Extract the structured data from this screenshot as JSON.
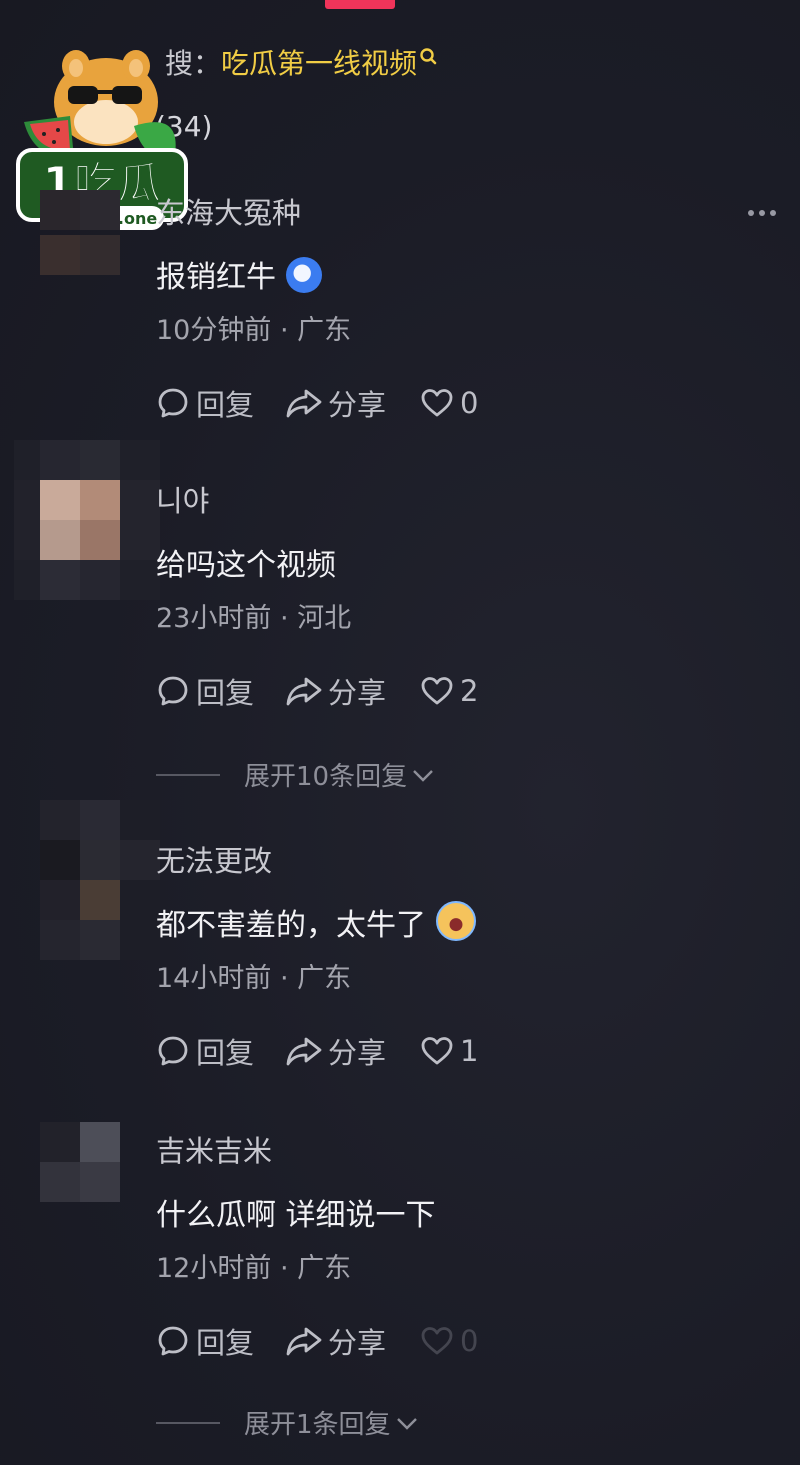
{
  "search_hint": {
    "prefix": "大家都在搜：",
    "visible_prefix": "搜：",
    "query": "吃瓜第一线视频"
  },
  "comment_count": "(34)",
  "logo": {
    "main": "1吃瓜",
    "site": "1chigua.one"
  },
  "comments": [
    {
      "username": "东海大冤种",
      "text": "报销红牛",
      "time": "10分钟前",
      "location": "广东",
      "reply_label": "回复",
      "share_label": "分享",
      "likes": "0"
    },
    {
      "username": "니야",
      "text": "给吗这个视频",
      "time": "23小时前",
      "location": "河北",
      "reply_label": "回复",
      "share_label": "分享",
      "likes": "2",
      "expand": "展开10条回复"
    },
    {
      "username": "无法更改",
      "text": "都不害羞的，太牛了",
      "time": "14小时前",
      "location": "广东",
      "reply_label": "回复",
      "share_label": "分享",
      "likes": "1"
    },
    {
      "username": "吉米吉米",
      "text": "什么瓜啊 详细说一下",
      "time": "12小时前",
      "location": "广东",
      "reply_label": "回复",
      "share_label": "分享",
      "likes": "0",
      "expand": "展开1条回复"
    }
  ],
  "separator": "·",
  "colors": {
    "background": "#1b1c26",
    "accent": "#f0345a",
    "query": "#f1cd45",
    "meta": "#a3a4ad"
  },
  "icons": [
    "search-icon",
    "comment-bubble-icon",
    "share-arrow-icon",
    "heart-icon",
    "chevron-down-icon",
    "more-icon"
  ]
}
